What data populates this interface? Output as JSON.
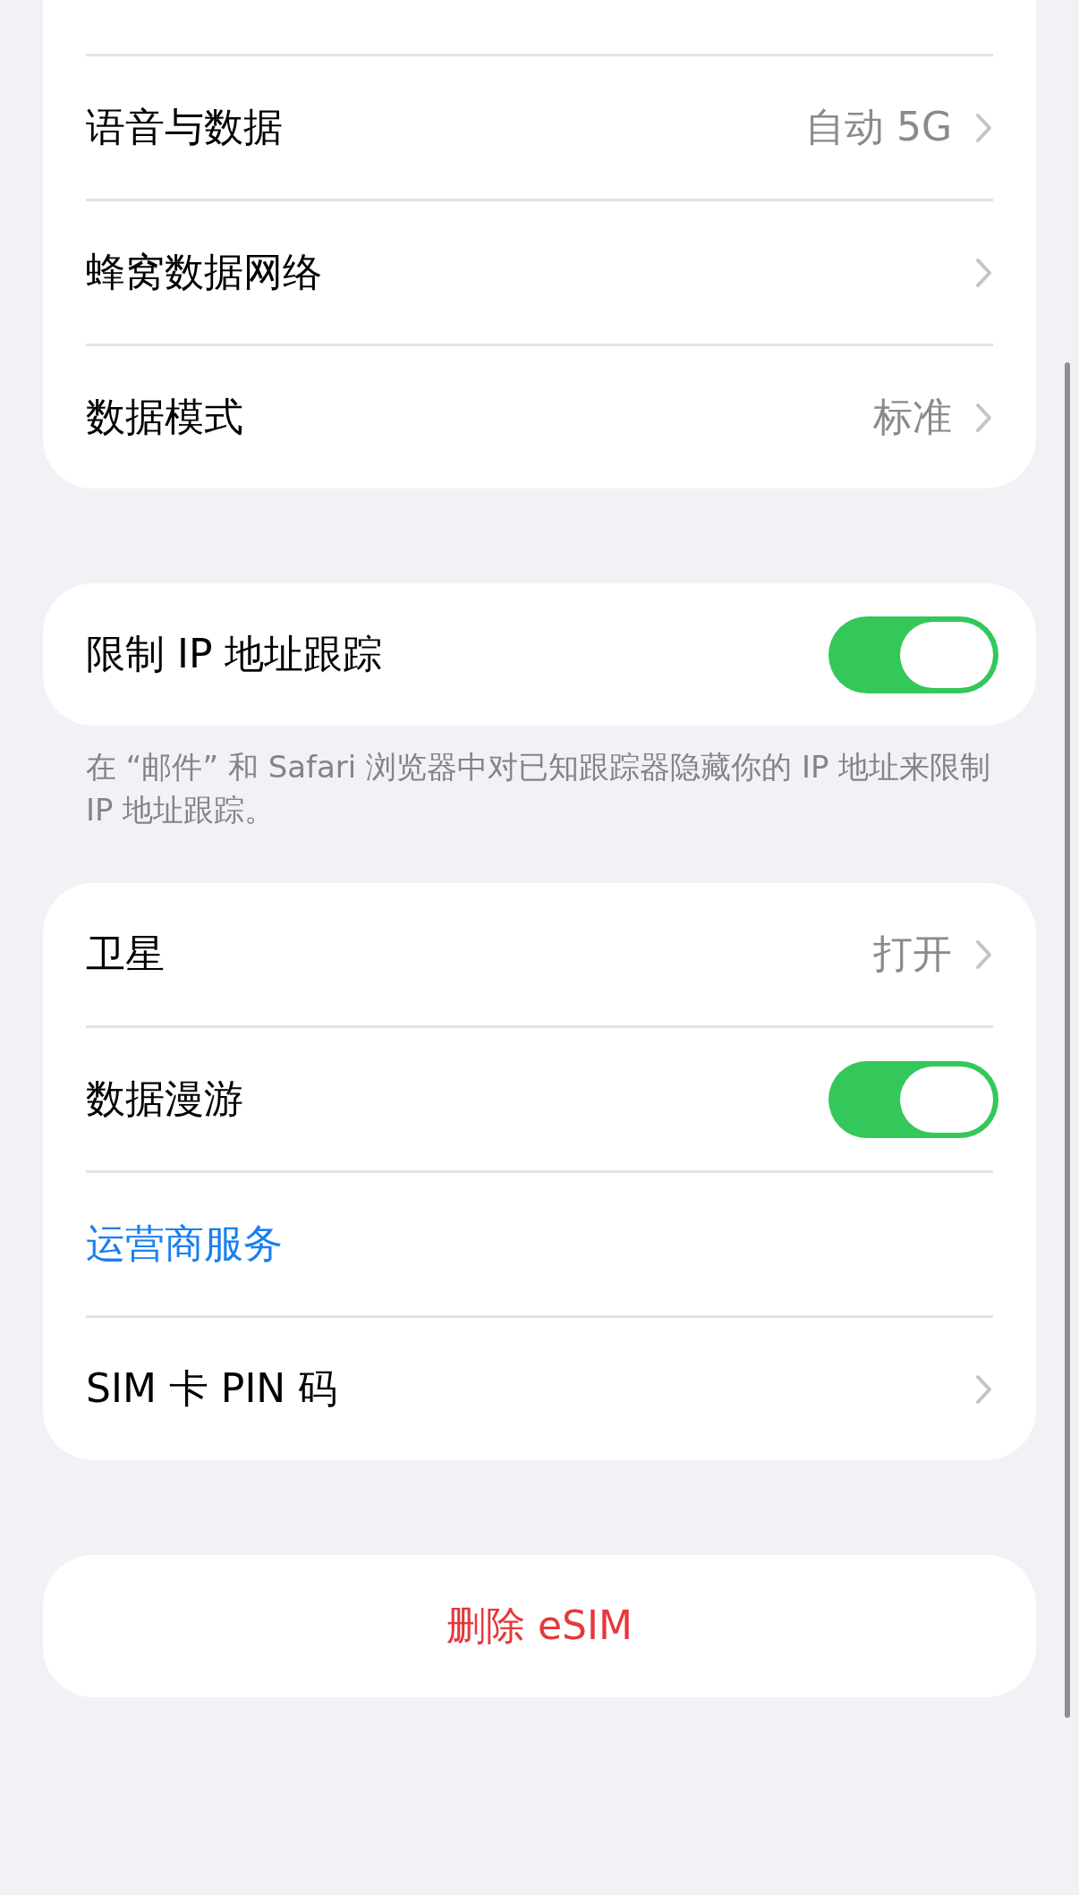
{
  "groups": [
    {
      "rows": [
        {
          "kind": "nav",
          "label": "语音与数据",
          "value": "自动 5G"
        },
        {
          "kind": "nav",
          "label": "蜂窝数据网络"
        },
        {
          "kind": "nav",
          "label": "数据模式",
          "value": "标准"
        }
      ]
    },
    {
      "rows": [
        {
          "kind": "toggle",
          "label": "限制 IP 地址跟踪",
          "on": true
        }
      ],
      "footer": "在 “邮件” 和 Safari 浏览器中对已知跟踪器隐藏你的 IP 地址来限制 IP 地址跟踪。"
    },
    {
      "rows": [
        {
          "kind": "nav",
          "label": "卫星",
          "value": "打开"
        },
        {
          "kind": "toggle",
          "label": "数据漫游",
          "on": true
        },
        {
          "kind": "link",
          "label": "运营商服务"
        },
        {
          "kind": "nav",
          "label": "SIM 卡 PIN 码"
        }
      ]
    }
  ],
  "delete_button": "删除 eSIM"
}
